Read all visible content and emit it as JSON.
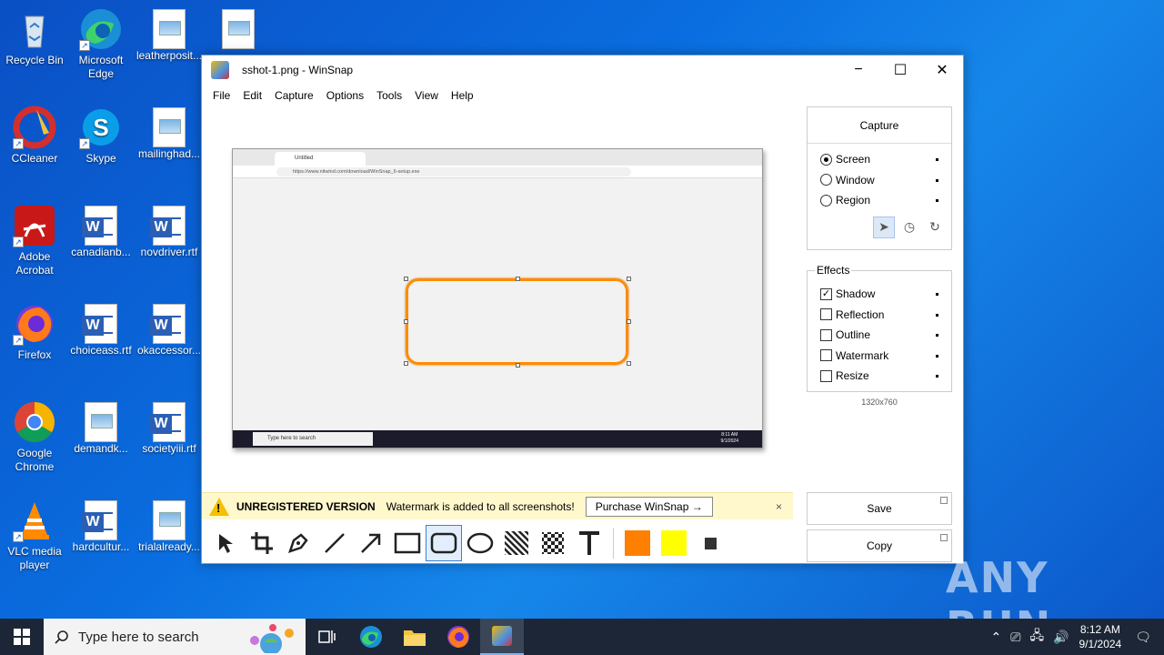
{
  "desktop": {
    "icons": [
      {
        "label": "Recycle Bin"
      },
      {
        "label": "Microsoft Edge"
      },
      {
        "label": "leatherposit..."
      },
      {
        "label": ""
      },
      {
        "label": "CCleaner"
      },
      {
        "label": "Skype"
      },
      {
        "label": "mailinghad..."
      },
      {
        "label": "Adobe Acrobat"
      },
      {
        "label": "canadianb..."
      },
      {
        "label": "novdriver.rtf"
      },
      {
        "label": "Firefox"
      },
      {
        "label": "choiceass.rtf"
      },
      {
        "label": "okaccessor..."
      },
      {
        "label": "Google Chrome"
      },
      {
        "label": "demandk..."
      },
      {
        "label": "societyiii.rtf"
      },
      {
        "label": "VLC media player"
      },
      {
        "label": "hardcultur..."
      },
      {
        "label": "trialalready..."
      }
    ]
  },
  "window": {
    "title": "sshot-1.png - WinSnap",
    "controls": {
      "minimize": "−",
      "maximize": "☐",
      "close": "✕"
    },
    "menu": [
      "File",
      "Edit",
      "Capture",
      "Options",
      "Tools",
      "View",
      "Help"
    ]
  },
  "screenshot_preview": {
    "tab_title": "Untitled",
    "address": "https://www.nitwind.com/download/WinSnap_6-setup.exe",
    "taskbar_search": "Type here to search",
    "time": "8:11 AM",
    "date": "9/1/2024"
  },
  "banner": {
    "title": "UNREGISTERED VERSION",
    "message": "Watermark is added to all screenshots!",
    "button": "Purchase WinSnap →",
    "close": "×"
  },
  "toolbar": {
    "tools": [
      "pointer-icon",
      "crop-icon",
      "pen-icon",
      "line-icon",
      "arrow-icon",
      "rectangle-icon",
      "rounded-rectangle-icon",
      "ellipse-icon",
      "hatch-icon",
      "pixelate-icon",
      "text-icon"
    ],
    "selected": "rounded-rectangle-icon",
    "colors": {
      "primary": "#ff7f00",
      "secondary": "#ffff00",
      "stroke": "#333333"
    }
  },
  "panel": {
    "capture_label": "Capture",
    "modes": [
      {
        "label": "Screen",
        "selected": true
      },
      {
        "label": "Window",
        "selected": false
      },
      {
        "label": "Region",
        "selected": false
      }
    ],
    "effects_title": "Effects",
    "effects": [
      {
        "label": "Shadow",
        "checked": true
      },
      {
        "label": "Reflection",
        "checked": false
      },
      {
        "label": "Outline",
        "checked": false
      },
      {
        "label": "Watermark",
        "checked": false
      },
      {
        "label": "Resize",
        "checked": false
      }
    ],
    "dimensions": "1320x760",
    "save_label": "Save",
    "copy_label": "Copy"
  },
  "taskbar": {
    "search_placeholder": "Type here to search",
    "time": "8:12 AM",
    "date": "9/1/2024"
  },
  "watermark": "ANY RUN"
}
